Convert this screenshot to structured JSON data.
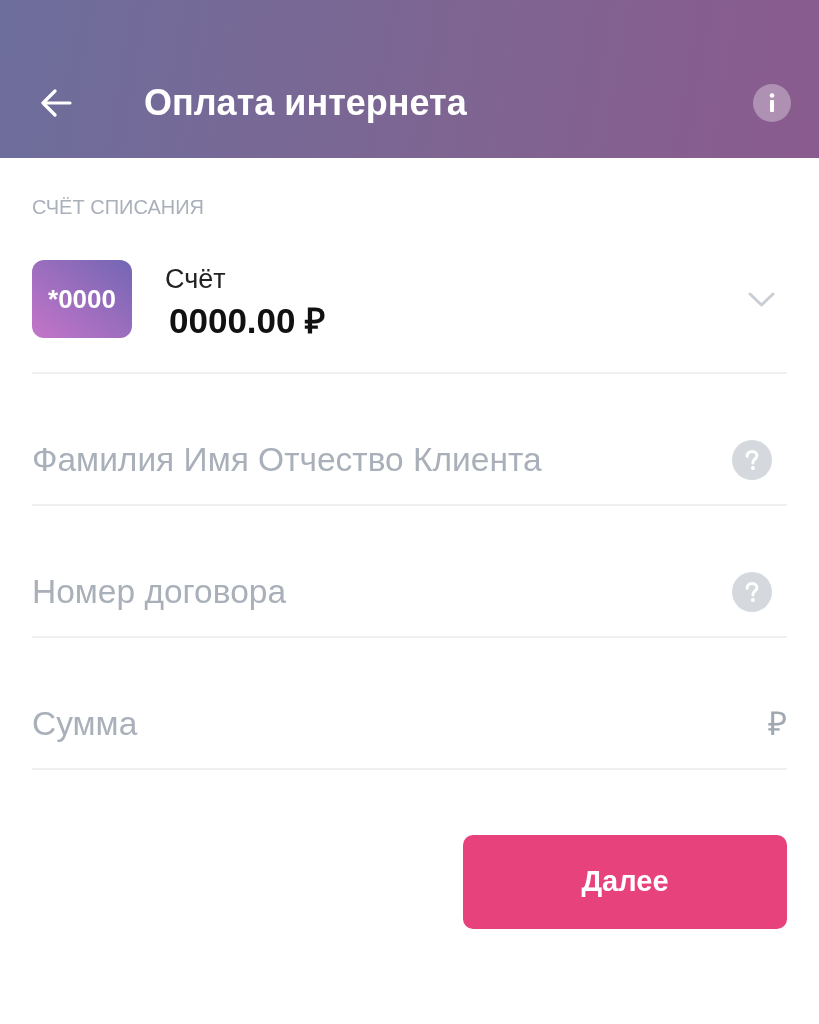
{
  "header": {
    "title": "Оплата интернета"
  },
  "account_section": {
    "label": "СЧЁТ СПИСАНИЯ",
    "account": {
      "card_mask": "*0000",
      "name": "Счёт",
      "balance": "0000.00 ₽"
    }
  },
  "fields": [
    {
      "kind": "help",
      "placeholder": "Фамилия Имя Отчество Клиента"
    },
    {
      "kind": "help",
      "placeholder": "Номер договора"
    },
    {
      "kind": "currency",
      "placeholder": "Сумма",
      "suffix": "₽"
    }
  ],
  "actions": {
    "next": "Далее"
  }
}
